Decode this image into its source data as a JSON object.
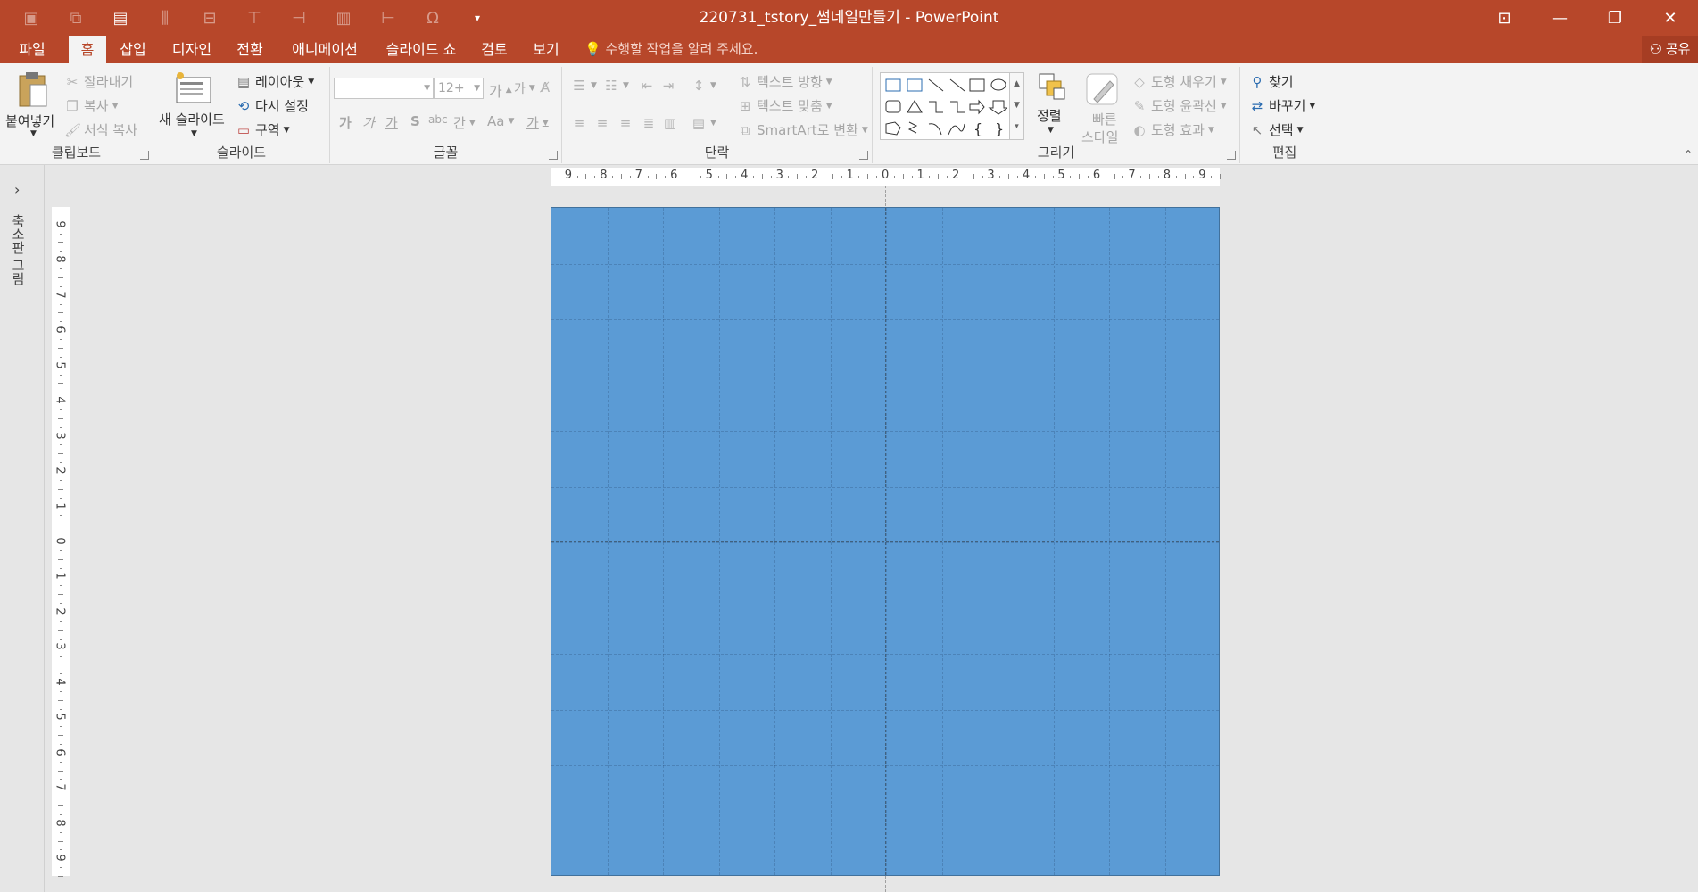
{
  "window": {
    "title": "220731_tstory_썸네일만들기 - PowerPoint",
    "controls": [
      "restore-ribbon",
      "minimize",
      "restore",
      "close"
    ]
  },
  "quick_access": [
    "save-icon",
    "undo-icon",
    "new-slide-icon",
    "align-icon",
    "distribute-icon",
    "align-center-icon",
    "align-top-icon",
    "chart-icon",
    "align-left-icon",
    "symbol-icon",
    "customize-icon"
  ],
  "tabs": {
    "file": "파일",
    "home": "홈",
    "insert": "삽입",
    "design": "디자인",
    "transitions": "전환",
    "animations": "애니메이션",
    "slideshow": "슬라이드 쇼",
    "review": "검토",
    "view": "보기",
    "tell_me": "수행할 작업을 알려 주세요.",
    "share": "공유"
  },
  "ribbon": {
    "clipboard": {
      "label": "클립보드",
      "paste": "붙여넣기",
      "cut": "잘라내기",
      "copy": "복사",
      "format_painter": "서식 복사"
    },
    "slides": {
      "label": "슬라이드",
      "new_slide": "새 슬라이드",
      "layout": "레이아웃",
      "reset": "다시 설정",
      "section": "구역"
    },
    "font": {
      "label": "글꼴",
      "font_name": "",
      "font_size": "12+",
      "grow": "가",
      "shrink": "가",
      "bold": "가",
      "italic": "가",
      "underline": "가",
      "shadow": "S",
      "strike": "abc",
      "spacing": "간",
      "case": "Aa",
      "color": "가"
    },
    "paragraph": {
      "label": "단락",
      "text_direction": "텍스트 방향",
      "align_text": "텍스트 맞춤",
      "smartart": "SmartArt로 변환"
    },
    "drawing": {
      "label": "그리기",
      "arrange": "정렬",
      "quick_styles_line1": "빠른",
      "quick_styles_line2": "스타일",
      "fill": "도형 채우기",
      "outline": "도형 윤곽선",
      "effects": "도형 효과"
    },
    "editing": {
      "label": "편집",
      "find": "찾기",
      "replace": "바꾸기",
      "select": "선택"
    }
  },
  "left_pane": {
    "label": "축소판 그림"
  },
  "ruler": {
    "horizontal": [
      "9",
      "8",
      "7",
      "6",
      "5",
      "4",
      "3",
      "2",
      "1",
      "0",
      "1",
      "2",
      "3",
      "4",
      "5",
      "6",
      "7",
      "8",
      "9"
    ],
    "vertical": [
      "9",
      "8",
      "7",
      "6",
      "5",
      "4",
      "3",
      "2",
      "1",
      "0",
      "1",
      "2",
      "3",
      "4",
      "5",
      "6",
      "7",
      "8",
      "9"
    ]
  },
  "slide": {
    "fill_color": "#5b9bd5"
  },
  "colors": {
    "accent": "#b7472a",
    "ribbon_bg": "#f3f3f3",
    "workspace_bg": "#e6e6e6"
  }
}
